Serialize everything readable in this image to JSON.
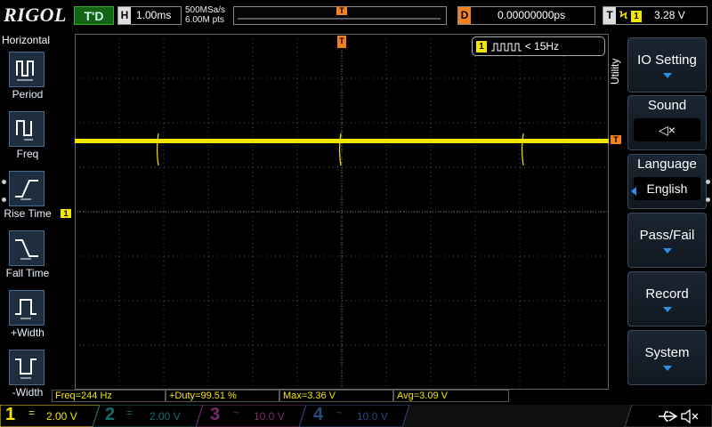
{
  "header": {
    "logo": "RIGOL",
    "trigger_status": "T'D",
    "timebase_tag": "H",
    "timebase": "1.00ms",
    "sample_rate": "500MSa/s",
    "memory_depth": "6.00M pts",
    "trigger_position_tag": "T",
    "delay_tag": "D",
    "delay": "0.00000000ps",
    "trigger_tag": "T",
    "trigger_edge": "Ϟ",
    "trigger_source": "1",
    "trigger_level": "3.28 V"
  },
  "left_menu": {
    "title": "Horizontal",
    "items": [
      {
        "label": "Period",
        "icon": "period-icon"
      },
      {
        "label": "Freq",
        "icon": "freq-icon"
      },
      {
        "label": "Rise Time",
        "icon": "rise-time-icon"
      },
      {
        "label": "Fall Time",
        "icon": "fall-time-icon"
      },
      {
        "label": "+Width",
        "icon": "plus-width-icon"
      },
      {
        "label": "-Width",
        "icon": "minus-width-icon"
      }
    ]
  },
  "freq_counter": {
    "channel": "1",
    "value": "< 15Hz"
  },
  "markers": {
    "trigger_level": "T",
    "channel1_ground": "1",
    "trigger_position": "T"
  },
  "right_menu": {
    "title": "Utility",
    "items": [
      {
        "label": "IO Setting",
        "type": "arrow"
      },
      {
        "label": "Sound",
        "value": "◁×",
        "type": "value"
      },
      {
        "label": "Language",
        "value": "English",
        "type": "value"
      },
      {
        "label": "Pass/Fail",
        "type": "arrow"
      },
      {
        "label": "Record",
        "type": "arrow"
      },
      {
        "label": "System",
        "type": "arrow"
      }
    ]
  },
  "measurements": [
    {
      "text": "Freq=244 Hz"
    },
    {
      "text": "+Duty=99.51 %"
    },
    {
      "text": "Max=3.36 V"
    },
    {
      "text": "Avg=3.09 V"
    }
  ],
  "channels": [
    {
      "num": "1",
      "coupling": "=",
      "scale": "2.00 V",
      "color": "#f2e600",
      "active": true
    },
    {
      "num": "2",
      "coupling": "=",
      "scale": "2.00 V",
      "color": "#1a6a6a",
      "active": false
    },
    {
      "num": "3",
      "coupling": "~",
      "scale": "10.0 V",
      "color": "#7a2a6a",
      "active": false
    },
    {
      "num": "4",
      "coupling": "~",
      "scale": "10.0 V",
      "color": "#2a4a7a",
      "active": false
    }
  ],
  "status_icons": [
    "usb-icon",
    "speaker-muted-icon"
  ],
  "colors": {
    "ch1": "#f2e600",
    "trigger": "#f08020",
    "menu_accent": "#2d8ee6"
  }
}
